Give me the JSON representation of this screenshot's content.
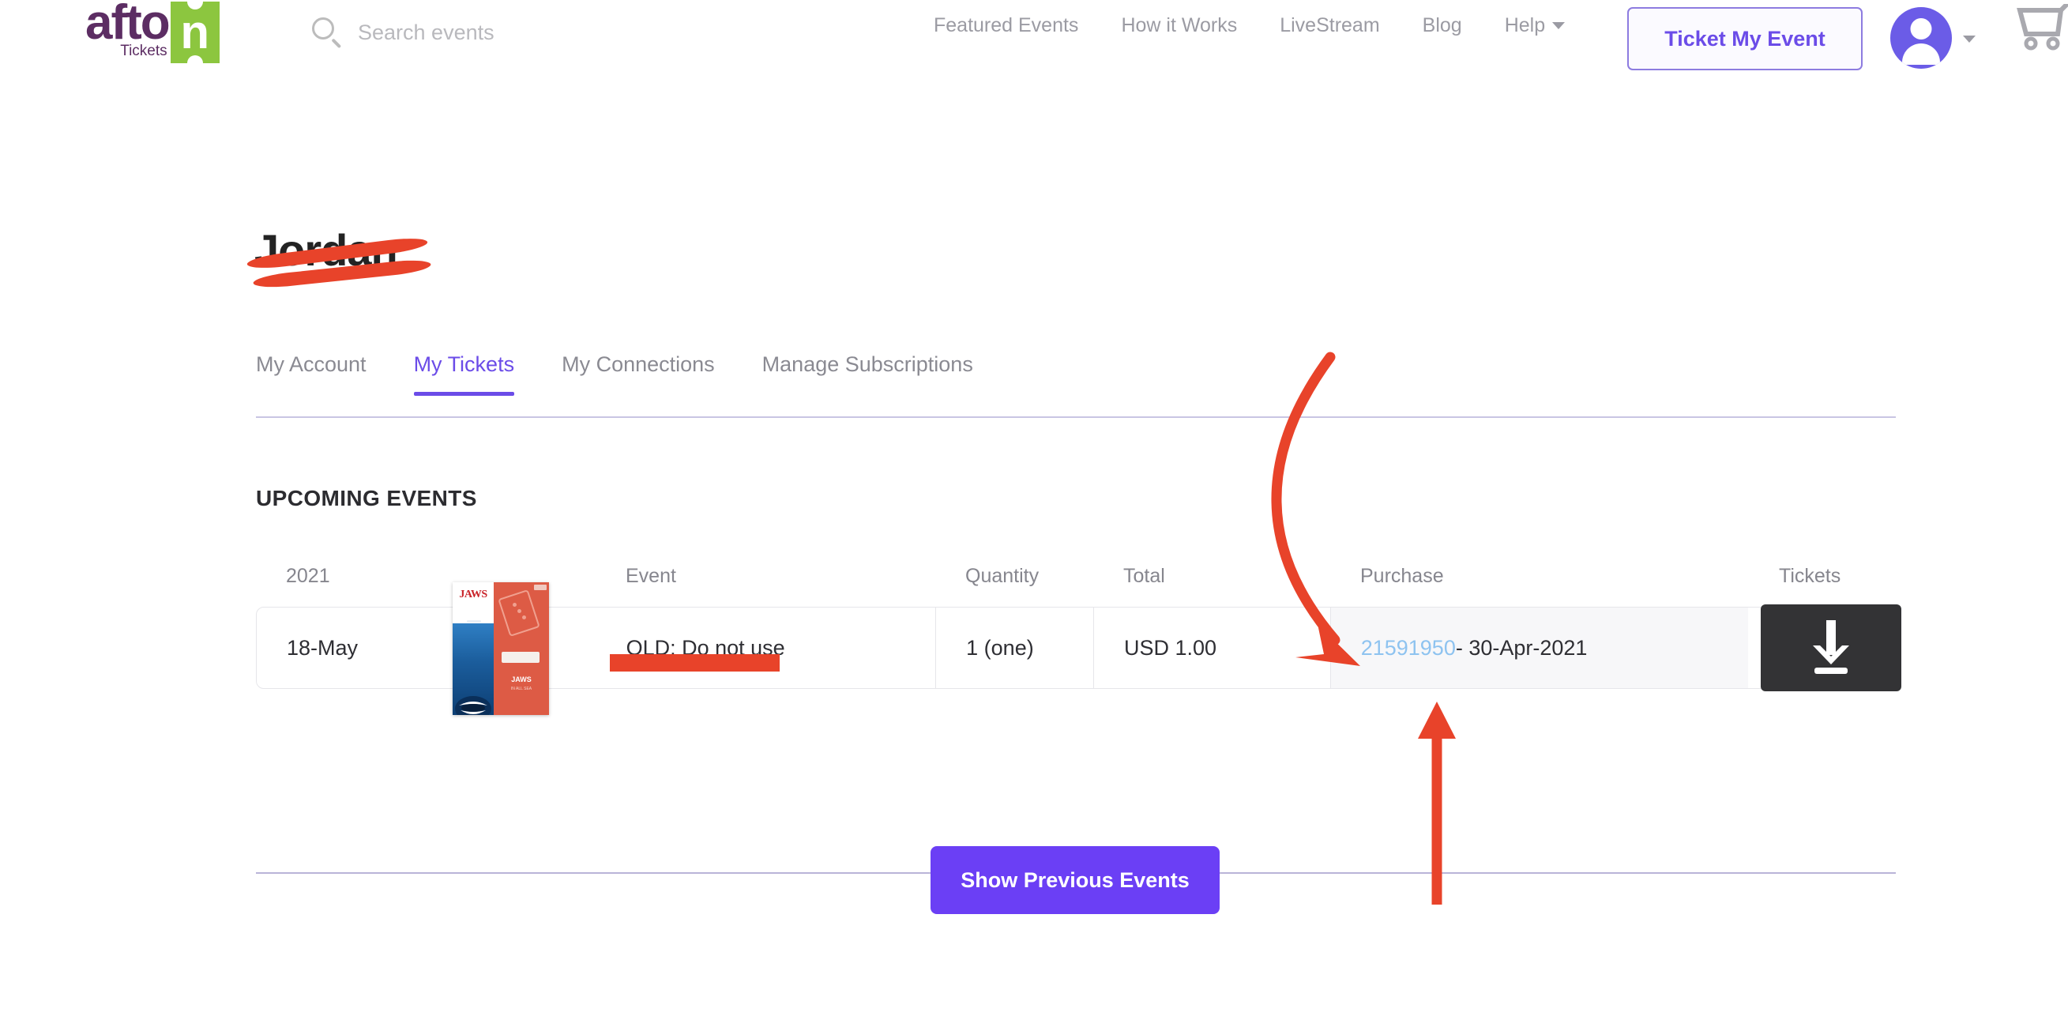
{
  "brand": {
    "name_main": "afto",
    "name_letter": "n",
    "sub": "Tickets",
    "green": "#8cc63f",
    "purple": "#5c2d63"
  },
  "search": {
    "placeholder": "Search events",
    "icon": "search-icon"
  },
  "nav": {
    "items": [
      {
        "label": "Featured Events",
        "caret": false
      },
      {
        "label": "How it Works",
        "caret": false
      },
      {
        "label": "LiveStream",
        "caret": false
      },
      {
        "label": "Blog",
        "caret": false
      },
      {
        "label": "Help",
        "caret": true
      }
    ]
  },
  "header": {
    "cta_label": "Ticket My Event",
    "avatar_icon": "user-avatar-icon",
    "cart_icon": "shopping-cart-icon",
    "accent": "#6b4ce8"
  },
  "account": {
    "user_name": "Jordan",
    "redacted": true
  },
  "tabs": [
    {
      "label": "My Account",
      "active": false
    },
    {
      "label": "My Tickets",
      "active": true
    },
    {
      "label": "My Connections",
      "active": false
    },
    {
      "label": "Manage Subscriptions",
      "active": false
    }
  ],
  "main": {
    "section_title": "UPCOMING EVENTS",
    "table": {
      "headers": [
        "2021",
        "Event",
        "Quantity",
        "Total",
        "Purchase",
        "Tickets"
      ],
      "rows": [
        {
          "date": "18-May",
          "thumbnail": "jaws-movie-poster",
          "thumb_title": "JAWS",
          "thumb_sub": "IN ALL SEA",
          "event": "OLD: Do not use",
          "event_redacted": true,
          "quantity": "1 (one)",
          "total": "USD 1.00",
          "purchase_id": "21591950",
          "purchase_rest": " - 30-Apr-2021",
          "ticket_action_icon": "download-icon"
        }
      ]
    },
    "show_previous_label": "Show Previous Events"
  },
  "annotations": {
    "curved_arrow": "red-curved-arrow-pointing-to-purchase-id",
    "straight_arrow": "red-up-arrow-pointing-to-purchase-cell",
    "color": "#e8432a"
  }
}
